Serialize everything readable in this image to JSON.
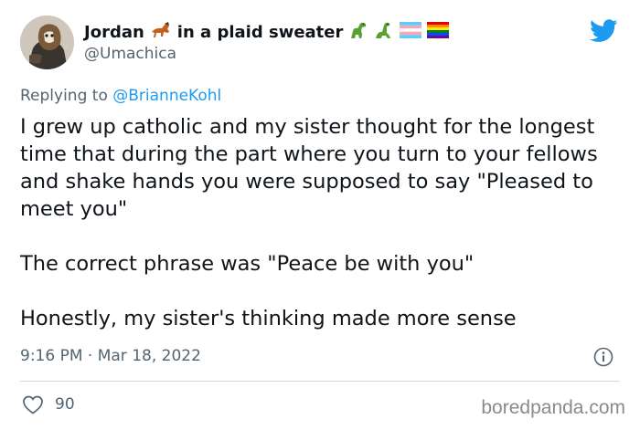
{
  "tweet": {
    "author": {
      "name": "Jordan",
      "name_suffix": "in a plaid sweater",
      "handle": "@Umachica",
      "icons": [
        "horse-emoji",
        "dinosaur-emoji",
        "dinosaur-emoji",
        "trans-flag-emoji",
        "pride-flag-emoji"
      ]
    },
    "replying_prefix": "Replying to",
    "replying_to": "@BrianneKohl",
    "paragraphs": [
      "I grew up catholic and my sister thought for the longest time that during the part where you turn to your fellows and shake hands you were supposed to say \"Pleased to meet you\"",
      "The correct phrase was \"Peace be with you\"",
      "Honestly, my sister's thinking made more sense"
    ],
    "timestamp": "9:16 PM · Mar 18, 2022",
    "likes": "90"
  },
  "watermark": "boredpanda.com",
  "colors": {
    "accent": "#1d9bf0",
    "secondary_text": "#536471",
    "divider": "#cfd9de"
  }
}
